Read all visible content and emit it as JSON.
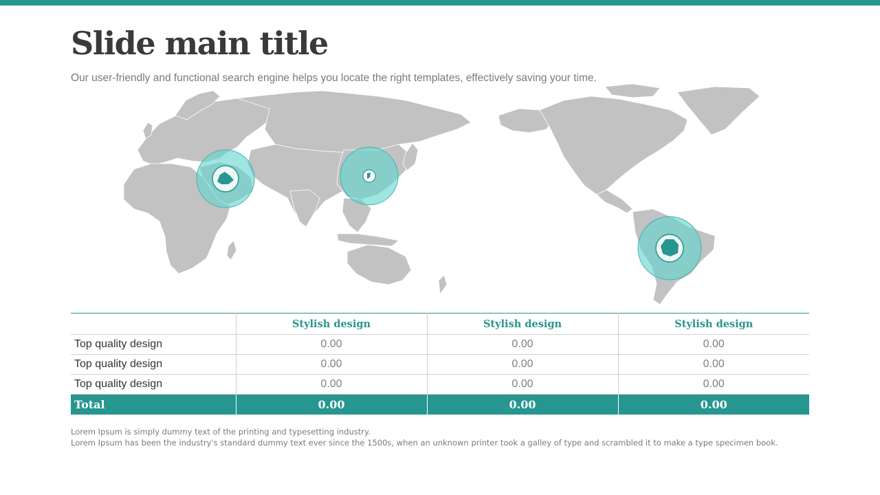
{
  "slide": {
    "title": "Slide main title",
    "subtitle": "Our user-friendly and functional search engine helps you locate the right templates, effectively saving your time."
  },
  "colors": {
    "accent": "#279590",
    "land": "#c2c2c2",
    "highlight_ring": "#5fd4cf",
    "highlight_country": "#279590"
  },
  "map": {
    "highlighted_regions": [
      "middle-east-marker",
      "korea-marker",
      "bolivia-marker"
    ]
  },
  "table": {
    "headers": [
      "",
      "Stylish design",
      "Stylish design",
      "Stylish design"
    ],
    "rows": [
      {
        "label": "Top quality design",
        "values": [
          "0.00",
          "0.00",
          "0.00"
        ]
      },
      {
        "label": "Top quality design",
        "values": [
          "0.00",
          "0.00",
          "0.00"
        ]
      },
      {
        "label": "Top quality design",
        "values": [
          "0.00",
          "0.00",
          "0.00"
        ]
      }
    ],
    "total": {
      "label": "Total",
      "values": [
        "0.00",
        "0.00",
        "0.00"
      ]
    }
  },
  "footnote": {
    "line1": "Lorem Ipsum is simply dummy text of the printing and typesetting industry.",
    "line2": "Lorem Ipsum has been the industry's standard dummy text ever since the 1500s, when an unknown printer took a galley of type and scrambled it to make a type specimen book."
  }
}
